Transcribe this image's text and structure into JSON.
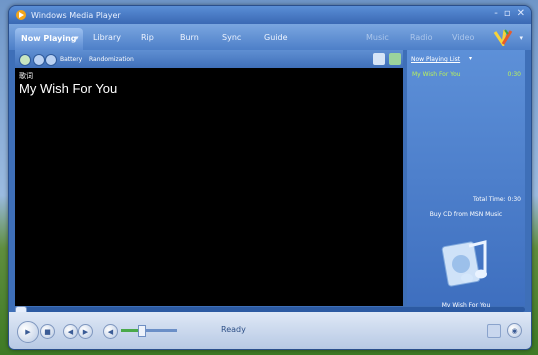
{
  "window": {
    "title": "Windows Media Player",
    "controls": [
      "-",
      "▫",
      "✕"
    ]
  },
  "tabs": {
    "items": [
      "Now Playing",
      "Library",
      "Rip",
      "Burn",
      "Sync",
      "Guide"
    ],
    "active": "Now Playing",
    "right_items": [
      "Music",
      "Radio",
      "Video"
    ]
  },
  "toolbar": {
    "visualization_labels": [
      "Battery",
      "Randomization"
    ]
  },
  "video": {
    "glyph_label": "歌词",
    "track_title": "My Wish For You"
  },
  "sidebar": {
    "header": "Now Playing List",
    "playlist": [
      {
        "title": "My Wish For You",
        "duration": "0:30"
      }
    ],
    "total_time": "Total Time: 0:30",
    "buy_link": "Buy CD from MSN Music",
    "now_playing_title": "My Wish For You"
  },
  "controls": {
    "status": "Ready",
    "volume_level": 0.35
  },
  "colors": {
    "accent": "#3e6fb8",
    "playlist_text": "#b9f25a",
    "video_bg": "#000000"
  }
}
